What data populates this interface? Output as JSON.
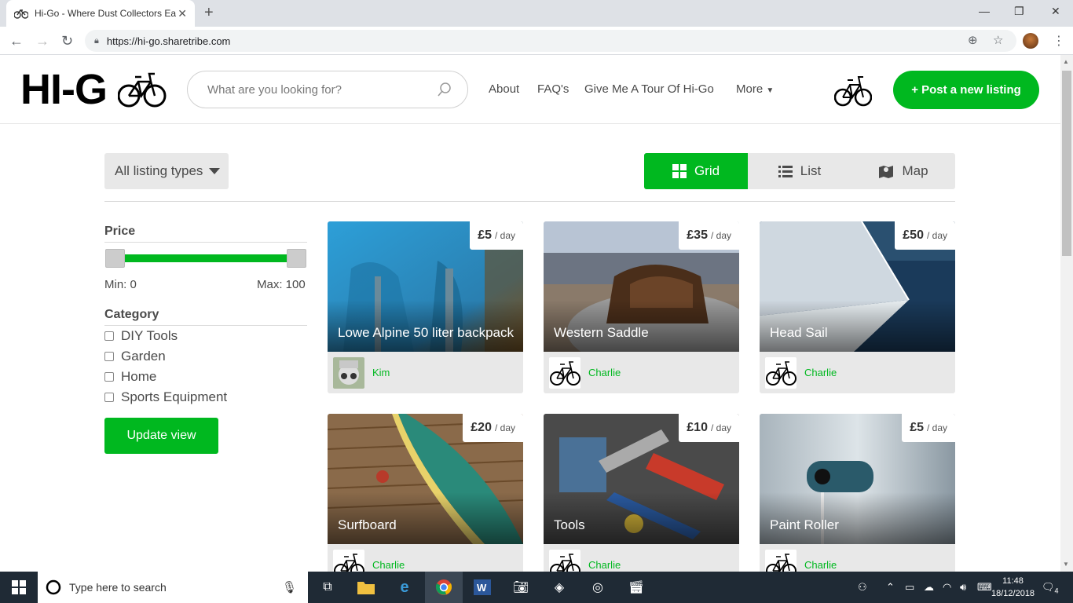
{
  "browser": {
    "tab_title": "Hi-Go - Where Dust Collectors Ea",
    "url": "https://hi-go.sharetribe.com"
  },
  "header": {
    "logo": "HI-G",
    "search_placeholder": "What are you looking for?",
    "nav": [
      "About",
      "FAQ's",
      "Give Me A Tour Of Hi-Go",
      "More"
    ],
    "post_button": "+ Post a new listing"
  },
  "filters": {
    "listing_type": "All listing types",
    "views": [
      "Grid",
      "List",
      "Map"
    ],
    "active_view": "Grid"
  },
  "sidebar": {
    "price_title": "Price",
    "min_label": "Min: 0",
    "max_label": "Max: 100",
    "category_title": "Category",
    "categories": [
      "DIY Tools",
      "Garden",
      "Home",
      "Sports Equipment"
    ],
    "update_button": "Update view"
  },
  "listings": [
    {
      "title": "Lowe Alpine 50 liter backpack",
      "price": "£5",
      "unit": "/ day",
      "author": "Kim"
    },
    {
      "title": "Western Saddle",
      "price": "£35",
      "unit": "/ day",
      "author": "Charlie"
    },
    {
      "title": "Head Sail",
      "price": "£50",
      "unit": "/ day",
      "author": "Charlie"
    },
    {
      "title": "Surfboard",
      "price": "£20",
      "unit": "/ day",
      "author": "Charlie"
    },
    {
      "title": "Tools",
      "price": "£10",
      "unit": "/ day",
      "author": "Charlie"
    },
    {
      "title": "Paint Roller",
      "price": "£5",
      "unit": "/ day",
      "author": "Charlie"
    }
  ],
  "taskbar": {
    "search_placeholder": "Type here to search",
    "time": "11:48",
    "date": "18/12/2018",
    "notifications": "4"
  },
  "colors": {
    "accent": "#00b81f",
    "taskbar": "#1f2a35"
  }
}
